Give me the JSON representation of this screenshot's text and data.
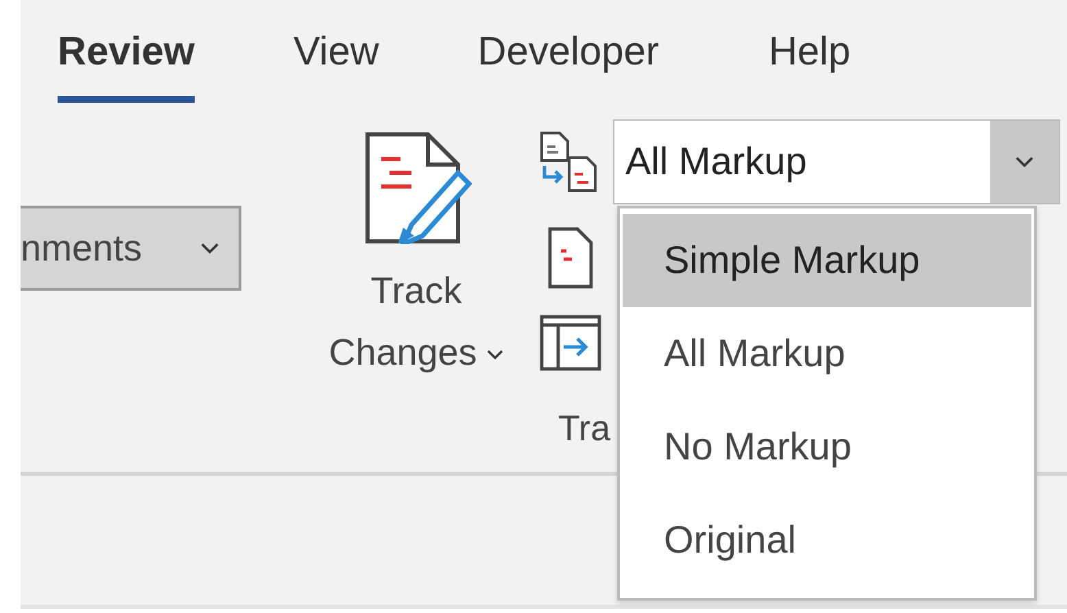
{
  "tabs": [
    {
      "label": "Review",
      "selected": true
    },
    {
      "label": "View",
      "selected": false
    },
    {
      "label": "Developer",
      "selected": false
    },
    {
      "label": "Help",
      "selected": false
    }
  ],
  "ribbon": {
    "comments_button": {
      "label": "nments"
    },
    "track_changes_button": {
      "label": "Track Changes"
    },
    "markup_select": {
      "value": "All Markup",
      "expanded": true,
      "options": [
        {
          "label": "Simple Markup",
          "highlighted": true
        },
        {
          "label": "All Markup",
          "highlighted": false
        },
        {
          "label": "No Markup",
          "highlighted": false
        },
        {
          "label": "Original",
          "highlighted": false
        }
      ]
    },
    "group_label": "Tra"
  }
}
